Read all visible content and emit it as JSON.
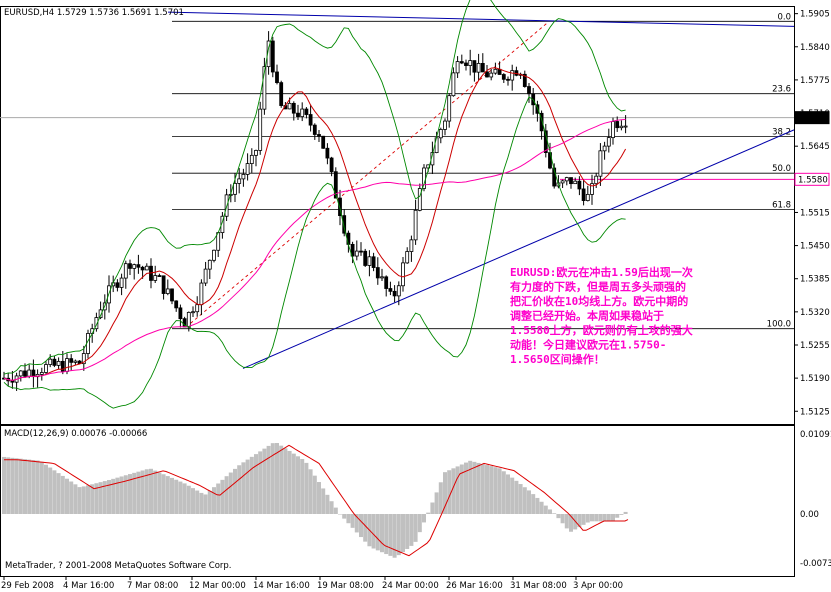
{
  "header": {
    "title": "EURUSD,H4  1.5729 1.5736 1.5691 1.5701"
  },
  "price_scale": [
    "1.5905",
    "1.5840",
    "1.5775",
    "1.5710",
    "1.5645",
    "1.5580",
    "1.5515",
    "1.5450",
    "1.5385",
    "1.5320",
    "1.5255",
    "1.5190",
    "1.5125"
  ],
  "price_marks": {
    "current": "1.5701",
    "level": "1.5580"
  },
  "fibonacci": {
    "levels": [
      {
        "label": "0.0",
        "value": 1.589
      },
      {
        "label": "23.6",
        "value": 1.5748
      },
      {
        "label": "38.2",
        "value": 1.5664
      },
      {
        "label": "50.0",
        "value": 1.5592
      },
      {
        "label": "61.8",
        "value": 1.5521
      },
      {
        "label": "100.0",
        "value": 1.5287
      }
    ]
  },
  "macd": {
    "label": "MACD(12,26,9) 0.00076 -0.00066",
    "scale": [
      "0.01091",
      "0.00",
      "-0.00738"
    ]
  },
  "time_axis": [
    "29 Feb 2008",
    "4 Mar 16:00",
    "7 Mar 08:00",
    "12 Mar 00:00",
    "14 Mar 16:00",
    "19 Mar 08:00",
    "24 Mar 00:00",
    "26 Mar 16:00",
    "31 Mar 08:00",
    "3 Apr 00:00"
  ],
  "copyright": "MetaTrader, ? 2001-2008 MetaQuotes Software Corp.",
  "annotation": [
    "EURUSD:欧元在冲击1.59后出现一次",
    "有力度的下跌，但是周五多头顽强的",
    "把汇价收在10均线上方。欧元中期的",
    "调整已经开始。本周如果稳站于",
    "1.5580上方，欧元则仍有上攻的强大",
    "动能！今日建议欧元在1.5750-",
    "1.5650区间操作！"
  ],
  "colors": {
    "ma_fast": "#cc0000",
    "ma_slow": "#ff00aa",
    "bollinger": "#008800",
    "trendline": "#0000aa",
    "annotation": "#ff00cc",
    "histogram": "#c0c0c0"
  },
  "chart_data": {
    "type": "line",
    "title": "EURUSD,H4",
    "x": [
      "29 Feb 2008",
      "4 Mar 16:00",
      "7 Mar 08:00",
      "12 Mar 00:00",
      "14 Mar 16:00",
      "19 Mar 08:00",
      "24 Mar 00:00",
      "26 Mar 16:00",
      "31 Mar 08:00",
      "3 Apr 00:00"
    ],
    "series": [
      {
        "name": "close",
        "values": [
          1.5195,
          1.533,
          1.542,
          1.55,
          1.584,
          1.552,
          1.538,
          1.582,
          1.576,
          1.5701
        ]
      }
    ],
    "ylim": [
      1.51,
      1.592
    ]
  }
}
